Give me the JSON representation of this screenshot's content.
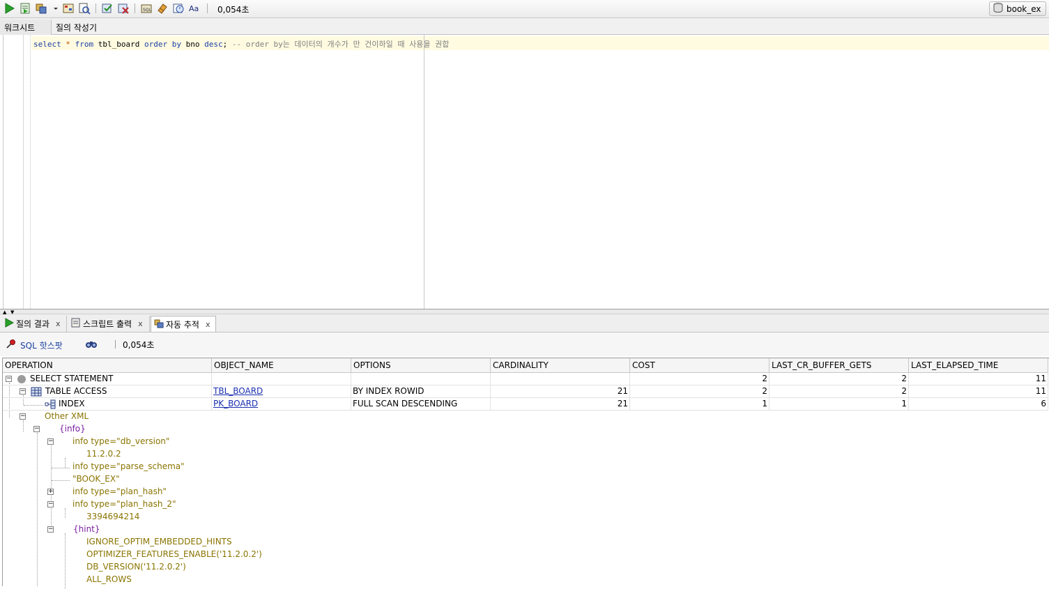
{
  "toolbar": {
    "icons": [
      "run-statement",
      "run-script",
      "autotrace",
      "explain-plan",
      "sql-tuning-advisor",
      "commit",
      "rollback",
      "unshared-sql-worksheet",
      "clear",
      "sql-history",
      "upper-lower-case"
    ],
    "elapsed": "0,054초",
    "connection": "book_ex"
  },
  "editor_tabs": {
    "worksheet": "워크시트",
    "query_builder": "질의 작성기"
  },
  "editor": {
    "kw_select": "select",
    "star": "*",
    "kw_from": "from",
    "table": "tbl_board",
    "kw_order_by": "order by",
    "column": "bno",
    "kw_desc": "desc",
    "semicolon": ";",
    "comment": "-- order by는 데이터의 개수가 만 건이하일 때 사용을 권합"
  },
  "result_tabs": [
    {
      "label": "질의 결과",
      "close": "x"
    },
    {
      "label": "스크립트 출력",
      "close": "x"
    },
    {
      "label": "자동 추적",
      "close": "x"
    }
  ],
  "trace": {
    "hotspot": "SQL 핫스팟",
    "elapsed": "0,054초"
  },
  "grid": {
    "columns": [
      "OPERATION",
      "OBJECT_NAME",
      "OPTIONS",
      "CARDINALITY",
      "COST",
      "LAST_CR_BUFFER_GETS",
      "LAST_ELAPSED_TIME"
    ],
    "rows": [
      {
        "operation": "SELECT STATEMENT",
        "object_name": "",
        "options": "",
        "cardinality": "",
        "cost": "2",
        "buffer_gets": "2",
        "elapsed": "11"
      },
      {
        "operation": "TABLE ACCESS",
        "object_name": "TBL_BOARD",
        "options": "BY INDEX ROWID",
        "cardinality": "21",
        "cost": "2",
        "buffer_gets": "2",
        "elapsed": "11"
      },
      {
        "operation": "INDEX",
        "object_name": "PK_BOARD",
        "options": "FULL SCAN DESCENDING",
        "cardinality": "21",
        "cost": "1",
        "buffer_gets": "1",
        "elapsed": "6"
      }
    ],
    "other_xml": {
      "label": "Other XML",
      "info": "{info}",
      "db_version": "info type=\"db_version\"",
      "db_version_value": "11.2.0.2",
      "parse_schema": "info type=\"parse_schema\"",
      "parse_schema_value": "\"BOOK_EX\"",
      "plan_hash": "info type=\"plan_hash\"",
      "plan_hash_2": "info type=\"plan_hash_2\"",
      "plan_hash_2_value": "3394694214",
      "hint": "{hint}",
      "hints": [
        "IGNORE_OPTIM_EMBEDDED_HINTS",
        "OPTIMIZER_FEATURES_ENABLE('11.2.0.2')",
        "DB_VERSION('11.2.0.2')",
        "ALL_ROWS"
      ]
    }
  },
  "colors": {
    "keyword": "#1b3ea4",
    "comment": "#7f7f7f",
    "link": "#1a2fb0",
    "xml_text": "#8a7400",
    "xml_brace": "#7a1fa0"
  }
}
